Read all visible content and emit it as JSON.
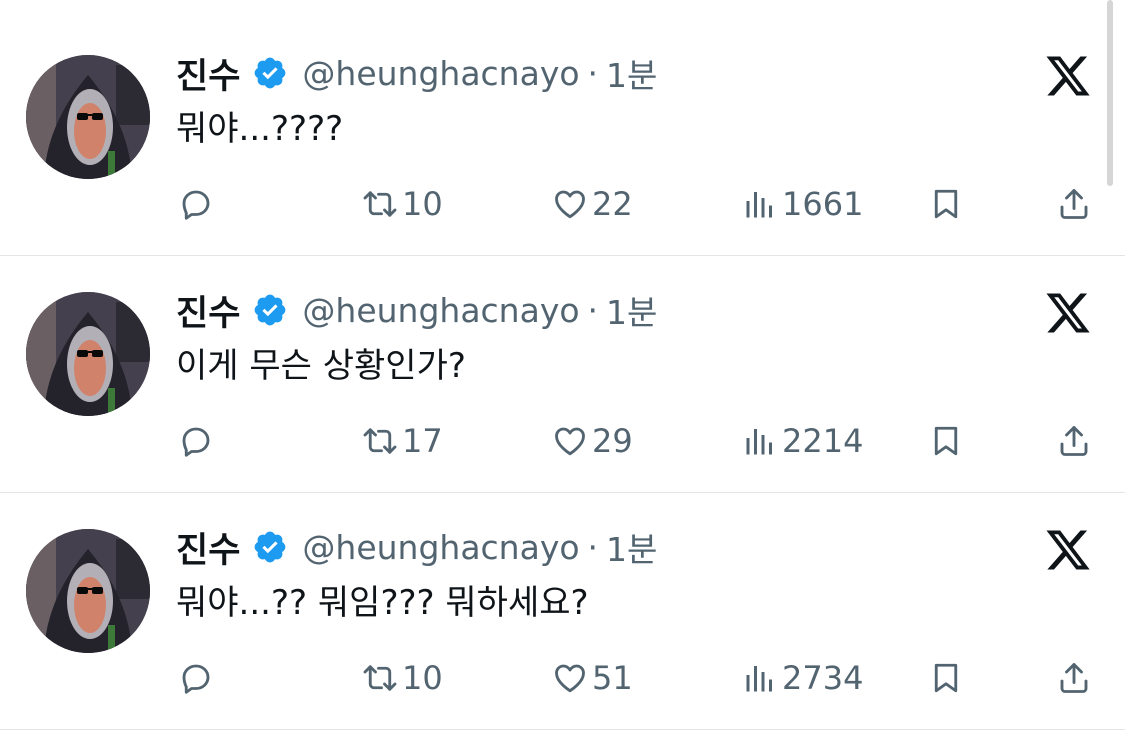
{
  "colors": {
    "text": "#0f1419",
    "secondary": "#536471",
    "verified": "#1d9bf0",
    "divider": "#e3e5e8"
  },
  "icons": {
    "verified": "verified-badge-icon",
    "brand": "x-logo-icon",
    "reply": "reply-icon",
    "retweet": "retweet-icon",
    "like": "heart-icon",
    "views": "views-bar-chart-icon",
    "bookmark": "bookmark-icon",
    "share": "share-icon"
  },
  "tweets": [
    {
      "name": "진수",
      "handle": "@heunghacnayo",
      "separator": "·",
      "time": "1분",
      "text": "뭐야...????",
      "retweets": "10",
      "likes": "22",
      "views": "1661"
    },
    {
      "name": "진수",
      "handle": "@heunghacnayo",
      "separator": "·",
      "time": "1분",
      "text": "이게 무슨 상황인가?",
      "retweets": "17",
      "likes": "29",
      "views": "2214"
    },
    {
      "name": "진수",
      "handle": "@heunghacnayo",
      "separator": "·",
      "time": "1분",
      "text": "뭐야...?? 뭐임??? 뭐하세요?",
      "retweets": "10",
      "likes": "51",
      "views": "2734"
    }
  ]
}
